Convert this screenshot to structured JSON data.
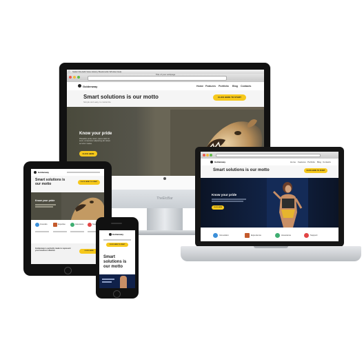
{
  "imac": {
    "brand": "TheEtcBar",
    "menubar": "Safari  File  Edit  View  History  Bookmarks  Window  Help",
    "window_title": "Title of your webpage",
    "site": {
      "logo": "Goldenway",
      "nav": [
        "Home",
        "Features",
        "Portfolio",
        "Blog",
        "Contacts"
      ],
      "motto": "Smart solutions is our motto",
      "subline": "Simple and easy to customize",
      "cta": "CLICK HERE TO START",
      "hero_title": "Know your pride",
      "hero_text": "Phasellus porta, lorem, ipsum dolor sit amet, consectetur adipiscing elit. Etiam ac tortor massa.",
      "hero_button": "CLICK HERE"
    }
  },
  "laptop": {
    "site": {
      "logo": "Goldenway",
      "nav": [
        "Home",
        "Features",
        "Portfolio",
        "Blog",
        "Contacts"
      ],
      "motto": "Smart solutions is our motto",
      "cta": "CLICK HERE TO START",
      "hero_title": "Know your pride",
      "hero_button": "CLICK HERE",
      "features": [
        "Innovation",
        "Experience",
        "Assurance",
        "Support"
      ]
    }
  },
  "tablet": {
    "site": {
      "logo": "Goldenway",
      "motto": "Smart solutions is our motto",
      "cta": "CLICK HERE TO START",
      "hero_title": "Know your pride",
      "features": [
        "Innovatio",
        "Expertise",
        "Assurance",
        "Support"
      ],
      "footer_text": "Goldenway is perfectly made to represent your business effective",
      "footer_button": "CLICK HERE"
    }
  },
  "phone": {
    "site": {
      "logo": "Goldenway",
      "motto": "Smart solutions is our motto",
      "cta": "CLICK HERE TO START"
    }
  },
  "colors": {
    "accent_yellow": "#f6c81b",
    "device_black": "#111111",
    "hero_dark": "#4a4a3c",
    "laptop_hero_blue": "#0d1a33"
  },
  "icons": [
    "apple-logo-icon",
    "lion-image",
    "woman-image",
    "feature-icons"
  ]
}
